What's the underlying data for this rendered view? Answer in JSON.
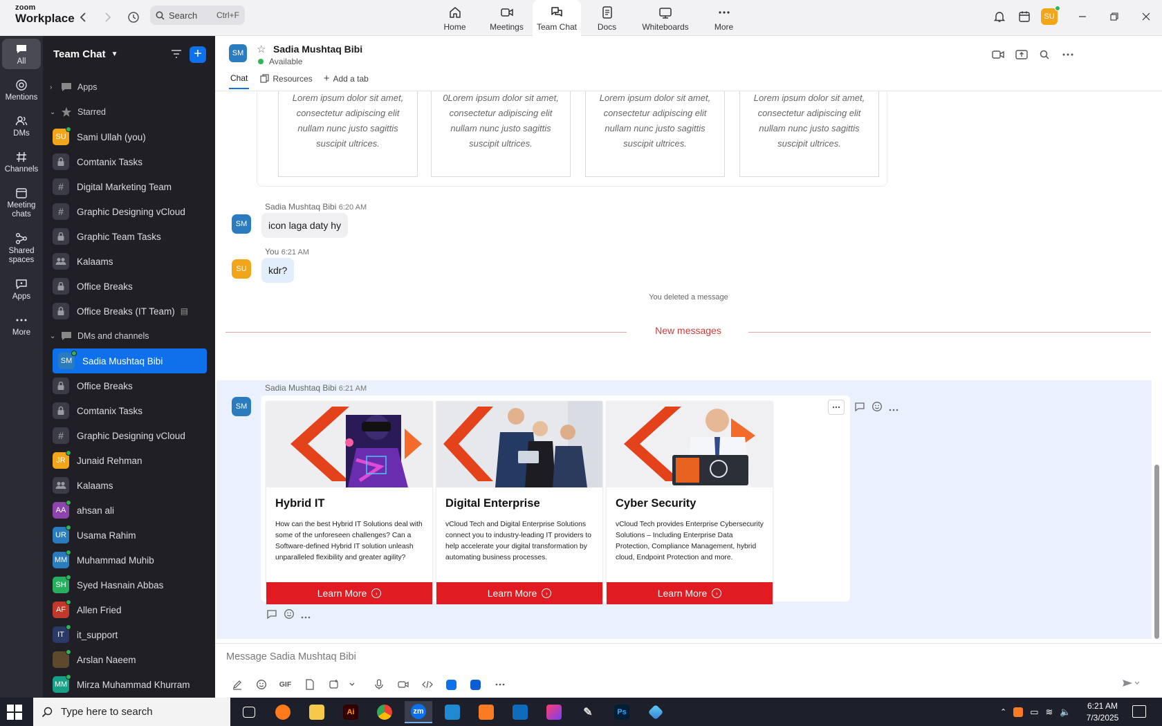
{
  "titlebar": {
    "brand_top": "zoom",
    "brand_bottom": "Workplace",
    "search_placeholder": "Search",
    "search_shortcut": "Ctrl+F",
    "user_initials": "SU",
    "tabs": [
      {
        "label": "Home",
        "icon": "home-icon"
      },
      {
        "label": "Meetings",
        "icon": "video-icon"
      },
      {
        "label": "Team Chat",
        "icon": "chat-icon"
      },
      {
        "label": "Docs",
        "icon": "doc-icon"
      },
      {
        "label": "Whiteboards",
        "icon": "whiteboard-icon"
      },
      {
        "label": "More",
        "icon": "more-icon"
      }
    ]
  },
  "rail": {
    "items": [
      {
        "label": "All",
        "icon": "chat-bubble-icon"
      },
      {
        "label": "Mentions",
        "icon": "at-icon"
      },
      {
        "label": "DMs",
        "icon": "people-icon"
      },
      {
        "label": "Channels",
        "icon": "hash-icon"
      },
      {
        "label": "Meeting chats",
        "icon": "calendar-icon"
      },
      {
        "label": "Shared spaces",
        "icon": "share-icon"
      },
      {
        "label": "Apps",
        "icon": "apps-icon"
      },
      {
        "label": "More",
        "icon": "more-icon"
      }
    ]
  },
  "sidebar": {
    "title": "Team Chat",
    "sections": {
      "apps": "Apps",
      "starred": "Starred",
      "dms": "DMs and channels"
    },
    "starred": [
      {
        "label": "Sami Ullah (you)",
        "initials": "SU",
        "kind": "avatar",
        "color": "#f0a51a"
      },
      {
        "label": "Comtanix Tasks",
        "kind": "lock"
      },
      {
        "label": "Digital Marketing Team",
        "kind": "hash"
      },
      {
        "label": "Graphic Designing vCloud",
        "kind": "hash"
      },
      {
        "label": "Graphic Team Tasks",
        "kind": "lock"
      },
      {
        "label": "Kalaams",
        "kind": "group"
      },
      {
        "label": "Office Breaks",
        "kind": "lock"
      },
      {
        "label": "Office Breaks (IT Team)",
        "kind": "lock"
      }
    ],
    "dms": [
      {
        "label": "Sadia Mushtaq Bibi",
        "initials": "SM",
        "kind": "avatar",
        "color": "#2b7cbf",
        "selected": true
      },
      {
        "label": "Office Breaks",
        "kind": "lock"
      },
      {
        "label": "Comtanix Tasks",
        "kind": "lock"
      },
      {
        "label": "Graphic Designing vCloud",
        "kind": "hash"
      },
      {
        "label": "Junaid Rehman",
        "initials": "JR",
        "kind": "avatar",
        "color": "#f0a51a"
      },
      {
        "label": "Kalaams",
        "kind": "group"
      },
      {
        "label": "ahsan ali",
        "initials": "AA",
        "kind": "avatar",
        "color": "#8e44ad"
      },
      {
        "label": "Usama Rahim",
        "initials": "UR",
        "kind": "avatar",
        "color": "#2b7cbf"
      },
      {
        "label": "Muhammad Muhib",
        "initials": "MM",
        "kind": "avatar",
        "color": "#2b7cbf"
      },
      {
        "label": "Syed Hasnain Abbas",
        "initials": "SH",
        "kind": "avatar",
        "color": "#27ae60"
      },
      {
        "label": "Allen Fried",
        "initials": "AF",
        "kind": "avatar",
        "color": "#c0392b"
      },
      {
        "label": "it_support",
        "initials": "IT",
        "kind": "avatar",
        "color": "#2a3a66"
      },
      {
        "label": "Arslan Naeem",
        "initials": "",
        "kind": "avatar",
        "color": "#5d4a2e"
      },
      {
        "label": "Mirza Muhammad Khurram",
        "initials": "MM",
        "kind": "avatar",
        "color": "#16a085"
      }
    ]
  },
  "chat": {
    "contact_name": "Sadia Mushtaq Bibi",
    "contact_initials": "SM",
    "status": "Available",
    "tabs": [
      "Chat",
      "Resources",
      "Add a tab"
    ],
    "lorem_cards": [
      "Lorem ipsum dolor sit amet, consectetur adipiscing elit nullam nunc justo sagittis suscipit ultrices.",
      "0Lorem ipsum dolor sit amet, consectetur adipiscing elit nullam nunc justo sagittis suscipit ultrices.",
      "Lorem ipsum dolor sit amet, consectetur adipiscing elit nullam nunc justo sagittis suscipit ultrices.",
      "Lorem ipsum dolor sit amet, consectetur adipiscing elit nullam nunc justo sagittis suscipit ultrices."
    ],
    "messages": [
      {
        "sender": "Sadia Mushtaq Bibi",
        "time": "6:20 AM",
        "text": "icon laga daty hy",
        "initials": "SM"
      },
      {
        "sender": "You",
        "time": "6:21 AM",
        "text": "kdr?",
        "initials": "SU"
      }
    ],
    "deleted_notice": "You deleted a message",
    "new_messages_label": "New messages",
    "last_message": {
      "sender": "Sadia Mushtaq Bibi",
      "time": "6:21 AM",
      "initials": "SM"
    },
    "cards": [
      {
        "title": "Hybrid IT",
        "desc": "How can the best Hybrid IT Solutions deal with some of the unforeseen challenges? Can a Software-defined Hybrid IT solution unleash unparalleled flexibility and greater agility?",
        "button": "Learn More"
      },
      {
        "title": "Digital Enterprise",
        "desc": "vCloud Tech and Digital Enterprise Solutions connect you to industry-leading IT providers to help accelerate your digital transformation by automating business processes.",
        "button": "Learn More"
      },
      {
        "title": "Cyber Security",
        "desc": "vCloud Tech provides Enterprise Cybersecurity Solutions – Including Enterprise Data Protection, Compliance Management, hybrid cloud, Endpoint Protection and more.",
        "button": "Learn More"
      }
    ],
    "composer_placeholder": "Message Sadia Mushtaq Bibi",
    "composer_gif": "GIF"
  },
  "taskbar": {
    "search_placeholder": "Type here to search",
    "time": "6:21 AM",
    "date": "7/3/2025",
    "apps": [
      {
        "name": "task-view"
      },
      {
        "name": "firefox"
      },
      {
        "name": "file-explorer"
      },
      {
        "name": "illustrator",
        "label": "Ai"
      },
      {
        "name": "chrome"
      },
      {
        "name": "zoom",
        "label": "zm"
      },
      {
        "name": "vscode"
      },
      {
        "name": "xampp"
      },
      {
        "name": "outlook"
      },
      {
        "name": "creative-cloud"
      },
      {
        "name": "pen-tool"
      },
      {
        "name": "photoshop",
        "label": "Ps"
      },
      {
        "name": "app-gem"
      }
    ]
  }
}
